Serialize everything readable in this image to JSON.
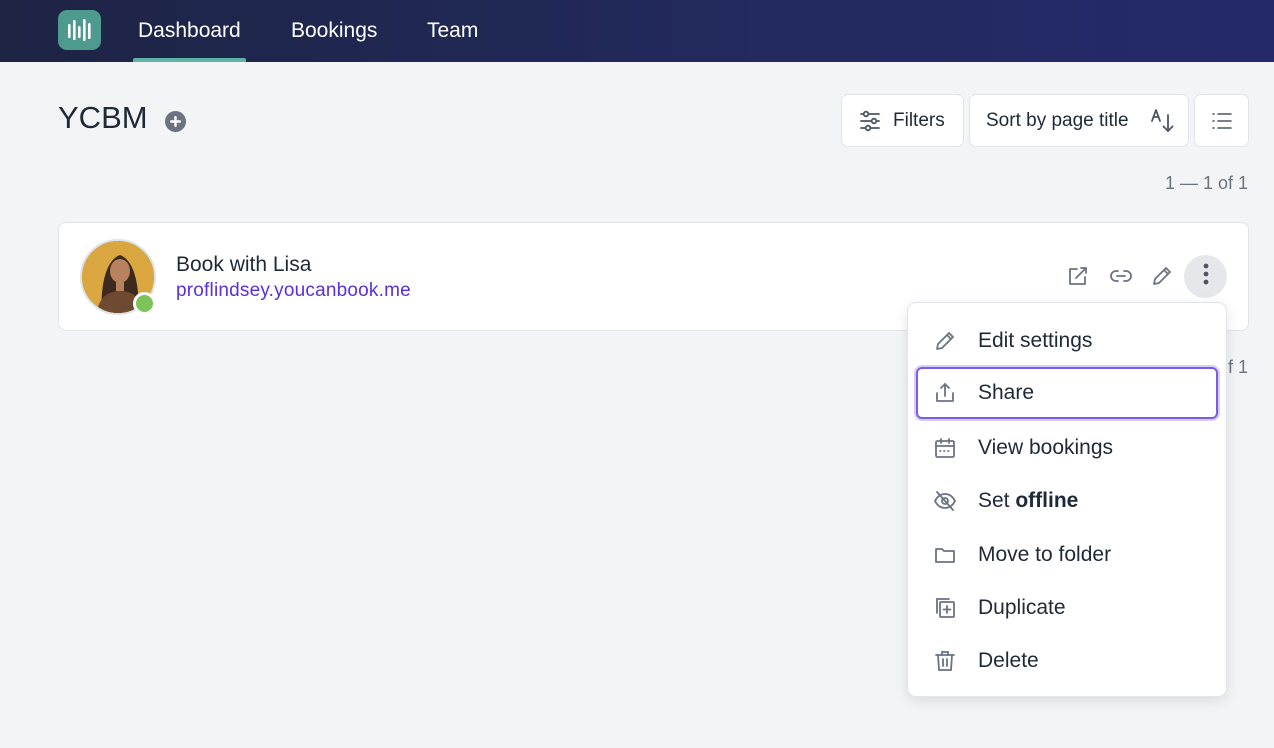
{
  "nav": {
    "logo_icon": "bars-logo-icon",
    "tabs": [
      {
        "label": "Dashboard",
        "active": true
      },
      {
        "label": "Bookings",
        "active": false
      },
      {
        "label": "Team",
        "active": false
      }
    ]
  },
  "page": {
    "title": "YCBM",
    "add_icon": "plus-circle-icon"
  },
  "toolbar": {
    "filters_label": "Filters",
    "sort_label": "Sort by page title",
    "sort_icon": "sort-alpha-icon",
    "view_icon": "list-view-icon"
  },
  "pagination": {
    "top": "1 — 1 of 1",
    "bottom_visible": "f 1"
  },
  "booking_page": {
    "title": "Book with Lisa",
    "url": "proflindsey.youcanbook.me",
    "status": "online",
    "status_color": "#7cc45a",
    "actions": [
      "open-external-icon",
      "link-icon",
      "pencil-icon",
      "more-vertical-icon"
    ]
  },
  "menu": {
    "items": [
      {
        "label": "Edit settings",
        "icon": "pencil-icon"
      },
      {
        "label": "Share",
        "icon": "share-upload-icon",
        "focused": true
      },
      {
        "label": "View bookings",
        "icon": "calendar-icon"
      },
      {
        "label_prefix": "Set ",
        "label_bold": "offline",
        "icon": "eye-off-icon"
      },
      {
        "label": "Move to folder",
        "icon": "folder-icon"
      },
      {
        "label": "Duplicate",
        "icon": "duplicate-icon"
      },
      {
        "label": "Delete",
        "icon": "trash-icon"
      }
    ]
  },
  "colors": {
    "nav_bg": "#222a5e",
    "accent": "#5fb3a6",
    "link": "#5b2ee0",
    "focus": "#7c5ce6"
  }
}
